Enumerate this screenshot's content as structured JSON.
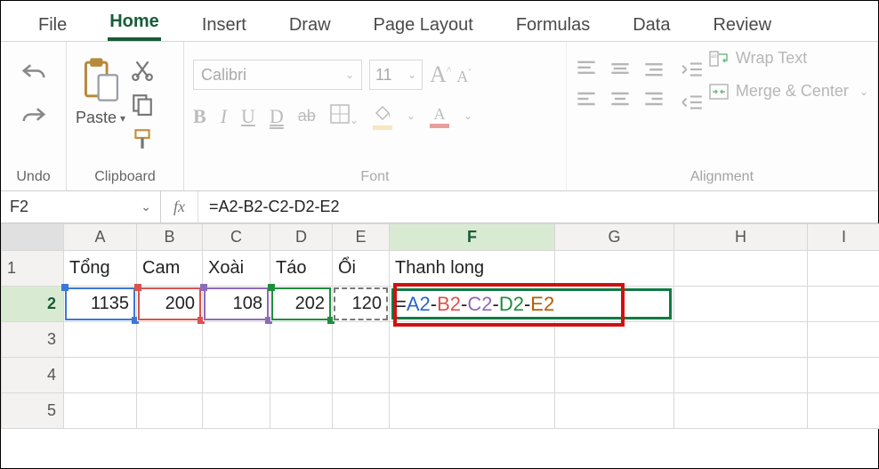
{
  "tabs": {
    "file": "File",
    "home": "Home",
    "insert": "Insert",
    "draw": "Draw",
    "page_layout": "Page Layout",
    "formulas": "Formulas",
    "data": "Data",
    "review": "Review"
  },
  "ribbon": {
    "undo_group": "Undo",
    "clipboard_group": "Clipboard",
    "paste_label": "Paste",
    "font_group": "Font",
    "font_name": "Calibri",
    "font_size": "11",
    "alignment_group": "Alignment",
    "wrap_text": "Wrap Text",
    "merge_center": "Merge & Center"
  },
  "formula_bar": {
    "name_box": "F2",
    "fx": "fx",
    "formula": "=A2-B2-C2-D2-E2"
  },
  "columns": [
    "A",
    "B",
    "C",
    "D",
    "E",
    "F",
    "G",
    "H",
    "I"
  ],
  "rows": [
    "1",
    "2",
    "3",
    "4",
    "5"
  ],
  "headers": {
    "A": "Tổng",
    "B": "Cam",
    "C": "Xoài",
    "D": "Táo",
    "E": "Ổi",
    "F": "Thanh long"
  },
  "values": {
    "A2": "1135",
    "B2": "200",
    "C2": "108",
    "D2": "202",
    "E2": "120"
  },
  "edit_cell": {
    "eq": "=",
    "A": "A2",
    "B": "B2",
    "C": "C2",
    "D": "D2",
    "E": "E2",
    "op": "-"
  }
}
